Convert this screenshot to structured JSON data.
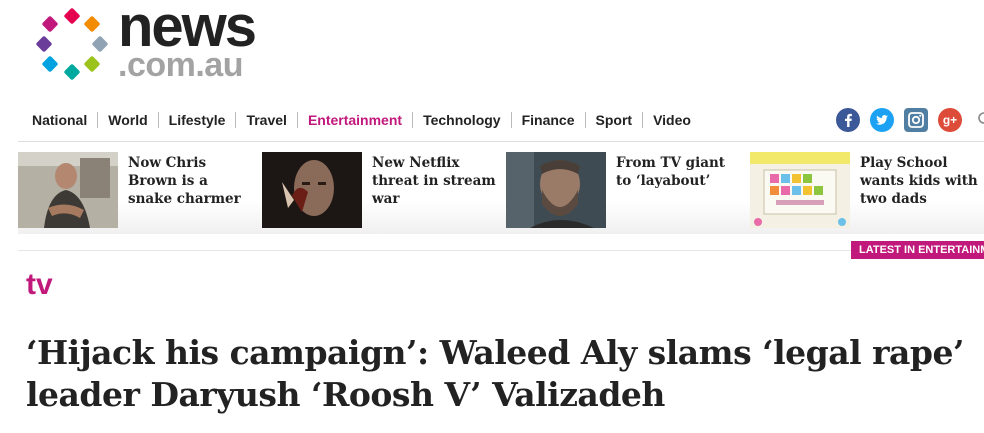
{
  "brand": {
    "name": "news",
    "domain": ".com.au"
  },
  "nav": {
    "items": [
      {
        "label": "National"
      },
      {
        "label": "World"
      },
      {
        "label": "Lifestyle"
      },
      {
        "label": "Travel"
      },
      {
        "label": "Entertainment",
        "active": true
      },
      {
        "label": "Technology"
      },
      {
        "label": "Finance"
      },
      {
        "label": "Sport"
      },
      {
        "label": "Video"
      }
    ],
    "active_color": "#c1187c"
  },
  "social": {
    "facebook_icon": "facebook-icon",
    "twitter_icon": "twitter-icon",
    "instagram_icon": "instagram-icon",
    "googleplus_icon": "googleplus-icon",
    "googleplus_glyph": "g+"
  },
  "related": [
    {
      "title": "Now Chris Brown is a snake charmer"
    },
    {
      "title": "New Netflix threat in stream war"
    },
    {
      "title": "From TV giant to ‘layabout’"
    },
    {
      "title": "Play School wants kids with two dads"
    }
  ],
  "latest_banner": "LATEST IN ENTERTAINMENT",
  "section": "tv",
  "headline": "‘Hijack his campaign’: Waleed Aly slams ‘legal rape’ leader Daryush ‘Roosh V’ Valizadeh",
  "colors": {
    "accent": "#c1187c",
    "text": "#222222"
  }
}
